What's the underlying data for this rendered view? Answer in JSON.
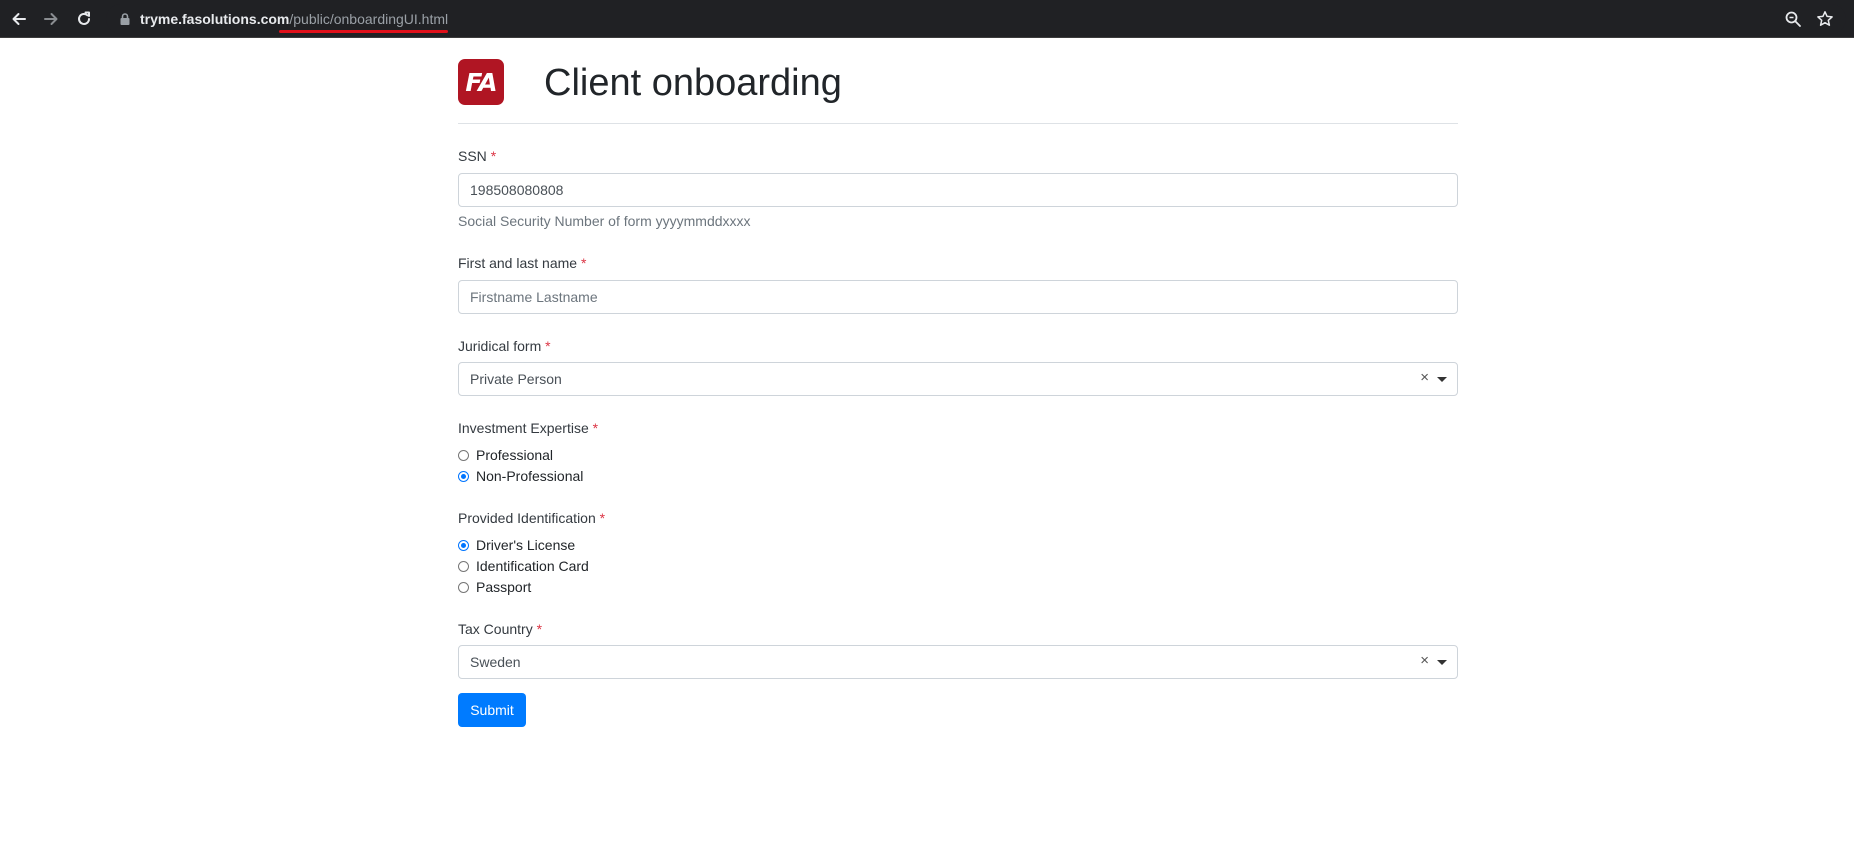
{
  "browser": {
    "url_host": "tryme.fasolutions.com",
    "url_path": "/public/onboardingUI.html"
  },
  "header": {
    "logo_text": "FA",
    "title": "Client onboarding"
  },
  "form": {
    "required_marker": "*",
    "ssn": {
      "label": "SSN",
      "value": "198508080808",
      "help": "Social Security Number of form yyyymmddxxxx"
    },
    "name": {
      "label": "First and last name",
      "placeholder": "Firstname Lastname"
    },
    "juridical_form": {
      "label": "Juridical form",
      "selected": "Private Person",
      "clear_symbol": "×"
    },
    "investment_expertise": {
      "label": "Investment Expertise",
      "options": [
        {
          "label": "Professional",
          "checked": false
        },
        {
          "label": "Non-Professional",
          "checked": true
        }
      ]
    },
    "identification": {
      "label": "Provided Identification",
      "options": [
        {
          "label": "Driver's License",
          "checked": true
        },
        {
          "label": "Identification Card",
          "checked": false
        },
        {
          "label": "Passport",
          "checked": false
        }
      ]
    },
    "tax_country": {
      "label": "Tax Country",
      "selected": "Sweden",
      "clear_symbol": "×"
    },
    "submit_label": "Submit"
  },
  "colors": {
    "brand": "#b01523",
    "primary": "#007bff",
    "required": "#dc3545",
    "radio_checked": "#0075ff",
    "url_highlight": "#e0101a"
  }
}
